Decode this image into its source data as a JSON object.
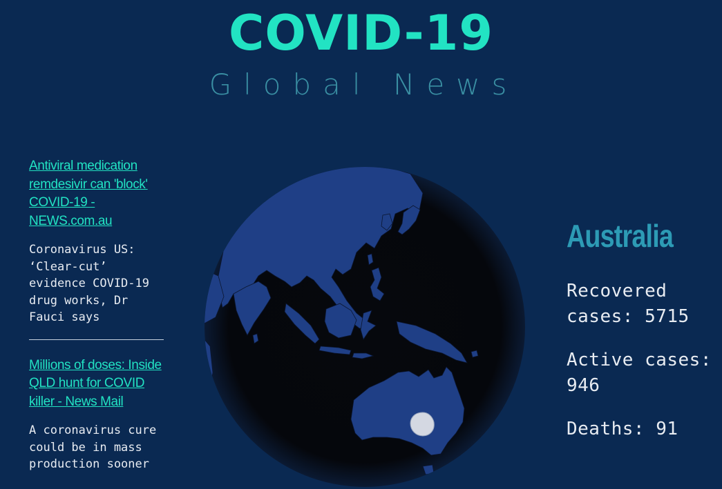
{
  "header": {
    "title": "COVID-19",
    "subtitle": "Global News"
  },
  "news": [
    {
      "headline": "Antiviral medication remdesivir can 'block' COVID-19 - NEWS.com.au",
      "description": "Coronavirus US: ‘Clear-cut’ evidence COVID-19 drug works, Dr Fauci says"
    },
    {
      "headline": "Millions of doses: Inside QLD hunt for COVID killer - News Mail",
      "description": "A coronavirus cure could be in mass production sooner"
    }
  ],
  "stats": {
    "country": "Australia",
    "recovered": "Recovered cases: 5715",
    "active": "Active cases: 946",
    "deaths": "Deaths: 91"
  },
  "colors": {
    "background": "#0a2952",
    "title": "#22e3c3",
    "subtitle": "#3a8fa3",
    "country": "#2d9bb5",
    "land": "#1f3f86",
    "ocean": "#05070c",
    "marker": "#d4d8e2"
  },
  "icons": {
    "globe": "world-globe-icon",
    "marker": "location-marker-icon"
  }
}
